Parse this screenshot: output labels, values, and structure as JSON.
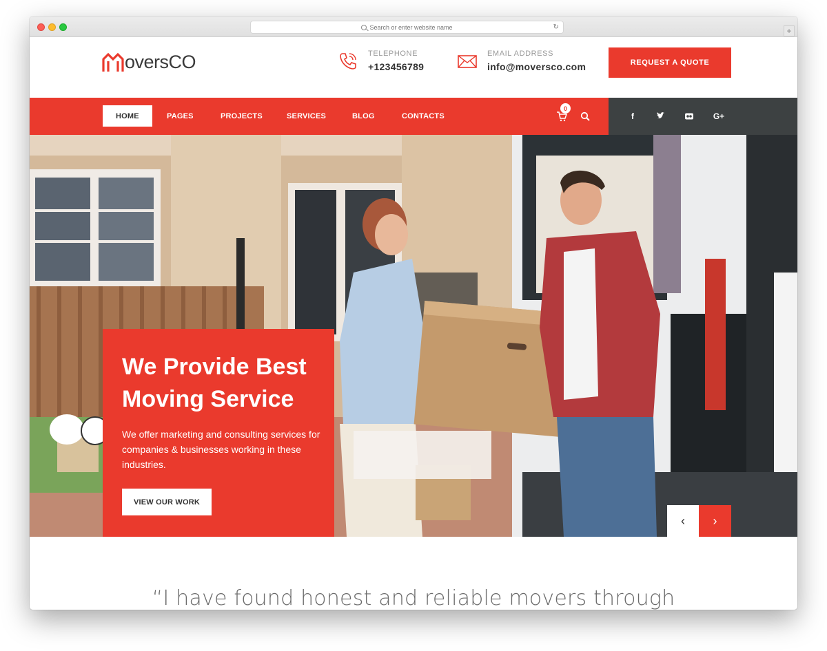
{
  "browser": {
    "url_placeholder": "Search or enter website name"
  },
  "header": {
    "logo_text": "oversCO",
    "telephone_label": "TELEPHONE",
    "telephone_value": "+123456789",
    "email_label": "EMAIL ADDRESS",
    "email_value": "info@moversco.com",
    "quote_button": "REQUEST A QUOTE"
  },
  "nav": {
    "items": [
      {
        "label": "HOME"
      },
      {
        "label": "PAGES"
      },
      {
        "label": "PROJECTS"
      },
      {
        "label": "SERVICES"
      },
      {
        "label": "BLOG"
      },
      {
        "label": "CONTACTS"
      }
    ],
    "cart_count": "0",
    "social": [
      "f",
      "t",
      "fl",
      "G+"
    ]
  },
  "hero": {
    "title": "We Provide Best Moving Service",
    "description": "We offer marketing and consulting services for companies & businesses working in these industries.",
    "button": "VIEW OUR WORK",
    "prev": "‹",
    "next": "›"
  },
  "testimonial": {
    "quote": "“I have found honest and reliable movers through"
  },
  "colors": {
    "accent": "#ea3a2d",
    "dark": "#3d4142"
  }
}
